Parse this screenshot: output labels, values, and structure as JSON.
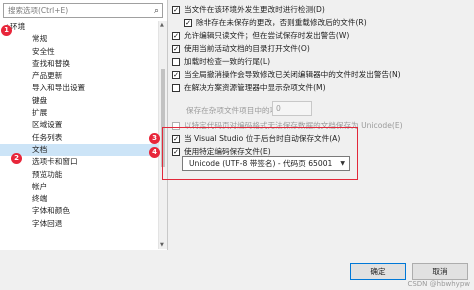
{
  "search": {
    "placeholder": "搜索选项(Ctrl+E)"
  },
  "tree": {
    "items": [
      {
        "label": "环境",
        "expanded": true
      },
      {
        "label": "常规"
      },
      {
        "label": "安全性"
      },
      {
        "label": "查找和替换"
      },
      {
        "label": "产品更新"
      },
      {
        "label": "导入和导出设置"
      },
      {
        "label": "键盘"
      },
      {
        "label": "扩展"
      },
      {
        "label": "区域设置"
      },
      {
        "label": "任务列表"
      },
      {
        "label": "文档",
        "selected": true
      },
      {
        "label": "选项卡和窗口"
      },
      {
        "label": "预览功能"
      },
      {
        "label": "帐户"
      },
      {
        "label": "终端"
      },
      {
        "label": "字体和颜色"
      },
      {
        "label": "字体回退"
      }
    ]
  },
  "annotations": {
    "badge1": "1",
    "badge2": "2",
    "badge3": "3",
    "badge4": "4"
  },
  "options": [
    {
      "label": "当文件在该环境外发生更改时进行检测(D)",
      "checked": true
    },
    {
      "label": "除非存在未保存的更改，否则重载修改后的文件(R)",
      "checked": true
    },
    {
      "label": "允许编辑只读文件；但在尝试保存时发出警告(W)",
      "checked": true
    },
    {
      "label": "使用当前活动文档的目录打开文件(O)",
      "checked": true
    },
    {
      "label": "加载时检查一致的行尾(L)",
      "checked": false
    },
    {
      "label": "当全局撤消操作会导致修改已关闭编辑器中的文件时发出警告(N)",
      "checked": true
    },
    {
      "label": "在解决方案资源管理器中显示杂项文件(M)",
      "checked": false
    }
  ],
  "misc_items": {
    "label": "保存在杂项文件项目中的项(S)",
    "value": "0"
  },
  "legacy_option": {
    "label": "以特定代码页对编码格式无法保存数据的文档保存为 Unicode(E)",
    "checked": false
  },
  "auto_save": {
    "label": "当 Visual Studio 位于后台时自动保存文件(A)",
    "checked": true
  },
  "encoding": {
    "label": "使用特定编码保存文件(E)",
    "checked": true,
    "selected": "Unicode (UTF-8 带签名) - 代码页 65001"
  },
  "buttons": {
    "ok": "确定",
    "cancel": "取消"
  },
  "watermark": "CSDN @hbwhypw",
  "colors": {
    "accent": "#0078d7",
    "highlight": "#e2283a",
    "selection": "#cce4f7"
  }
}
